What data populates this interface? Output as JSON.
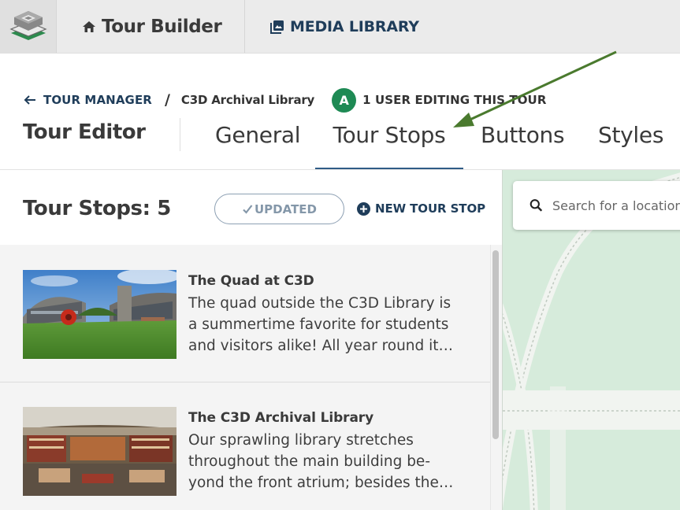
{
  "topbar": {
    "logo_icon": "c3d-logo-icon",
    "builder_icon": "home-icon",
    "builder_label": "Tour Builder",
    "media_icon": "photo-library-icon",
    "media_label": "MEDIA LIBRARY"
  },
  "breadcrumb": {
    "back_icon": "arrow-left-icon",
    "back_label": "TOUR MANAGER",
    "separator": "/",
    "current": "C3D Archival Library"
  },
  "editing": {
    "avatar_initial": "A",
    "label": "1 USER EDITING THIS TOUR"
  },
  "editor": {
    "title": "Tour Editor",
    "tabs": [
      {
        "label": "General"
      },
      {
        "label": "Tour Stops"
      },
      {
        "label": "Buttons"
      },
      {
        "label": "Styles"
      }
    ],
    "active_tab": "Tour Stops"
  },
  "stops": {
    "title": "Tour Stops: 5",
    "updated_label": "UPDATED",
    "updated_icon": "check-icon",
    "new_stop_icon": "add-circle-icon",
    "new_stop_label": "NEW TOUR STOP",
    "items": [
      {
        "name": "The Quad at C3D",
        "desc_lines": [
          "The quad outside the C3D Library is",
          "a summertime favorite for students",
          "and visitors alike! All year round it…"
        ]
      },
      {
        "name": "The C3D Archival Library",
        "desc_lines": [
          "Our sprawling library stretches",
          "throughout the main building be-",
          "yond the front atrium; besides the…"
        ]
      }
    ]
  },
  "map": {
    "search_icon": "search-icon",
    "search_placeholder": "Search for a location"
  },
  "colors": {
    "accent": "#1f3d5a",
    "avatar": "#1e8a54",
    "tab_underline": "#2f5c86",
    "map_green": "#d6ebdb",
    "annotation_arrow": "#4a7a2e"
  }
}
